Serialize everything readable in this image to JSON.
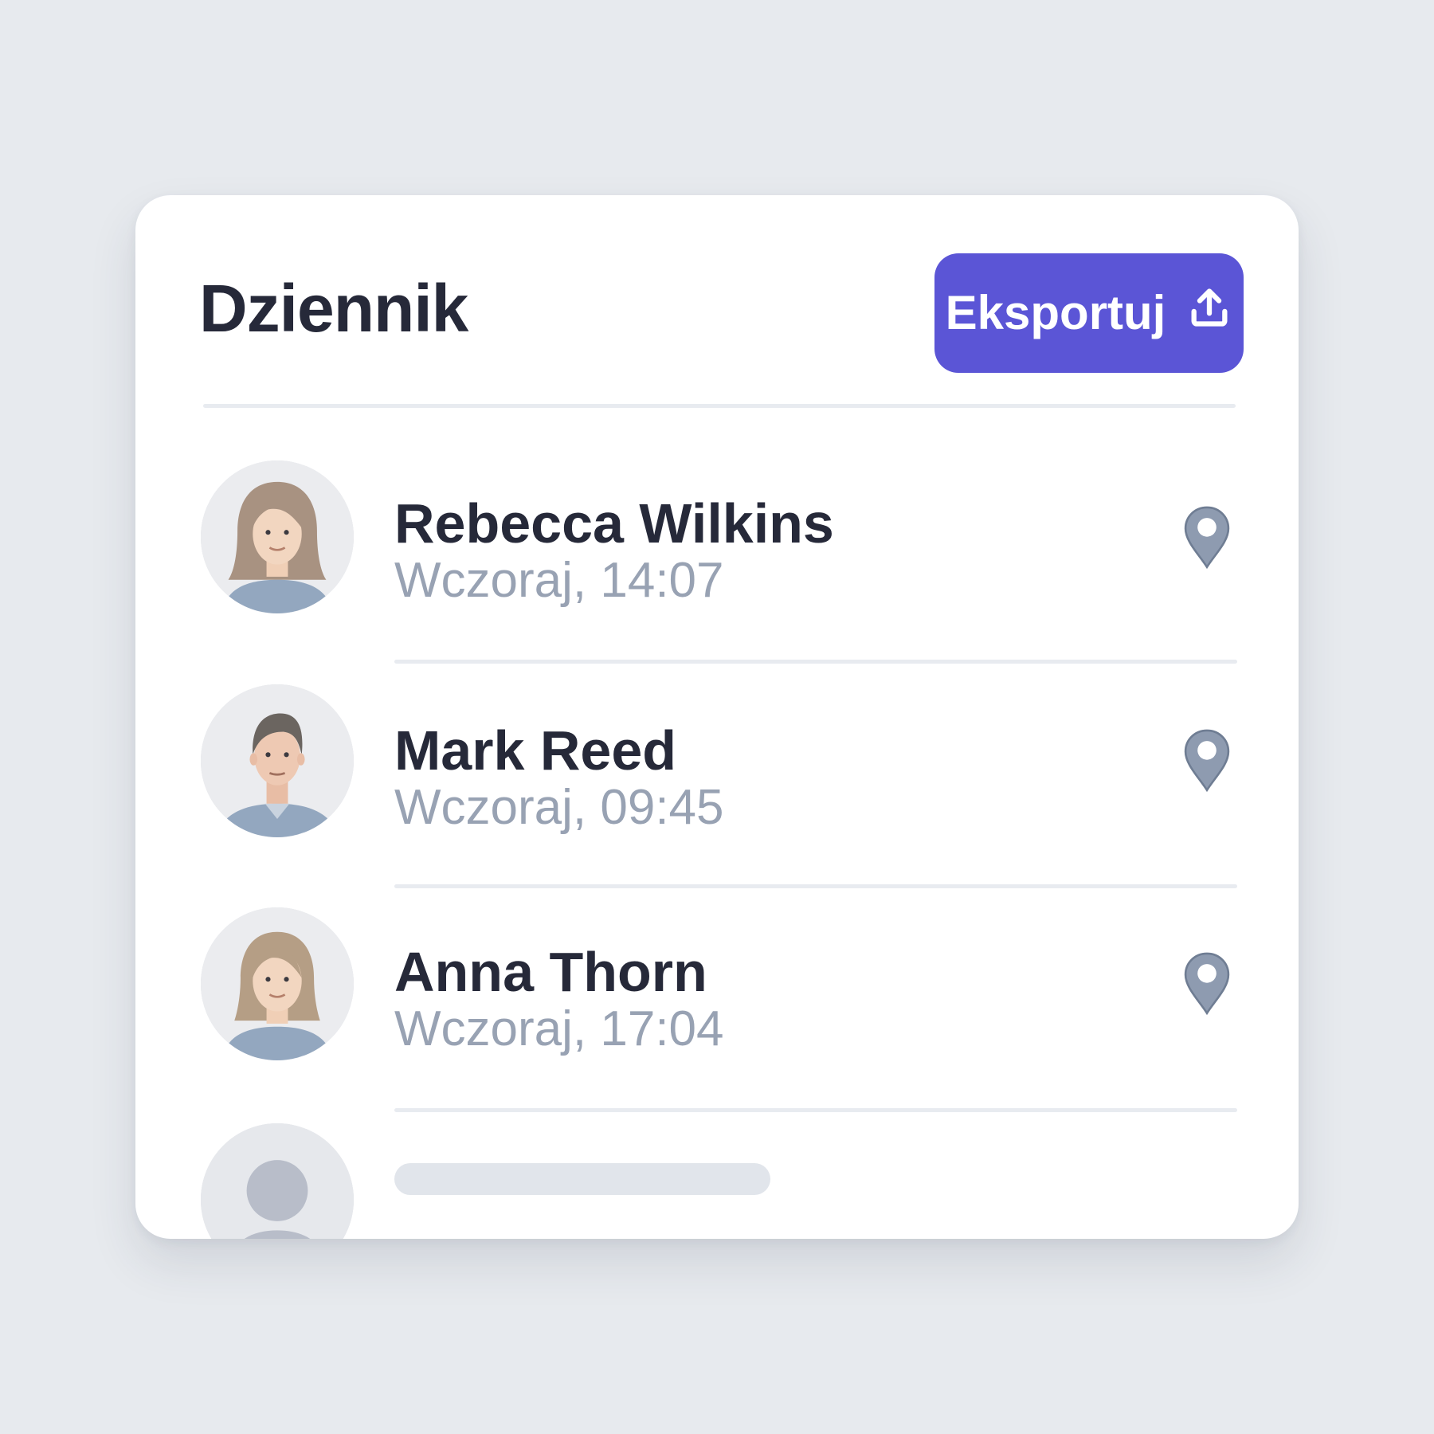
{
  "header": {
    "title": "Dziennik",
    "export_label": "Eksportuj",
    "export_icon": "upload-icon"
  },
  "colors": {
    "accent": "#5b55d6",
    "title": "#262939",
    "muted": "#98a2b3",
    "pin": "#8e9bb0"
  },
  "entries": [
    {
      "name": "Rebecca Wilkins",
      "time": "Wczoraj, 14:07",
      "icon": "location-pin-icon"
    },
    {
      "name": "Mark Reed",
      "time": "Wczoraj, 09:45",
      "icon": "location-pin-icon"
    },
    {
      "name": "Anna Thorn",
      "time": "Wczoraj, 17:04",
      "icon": "location-pin-icon"
    }
  ]
}
